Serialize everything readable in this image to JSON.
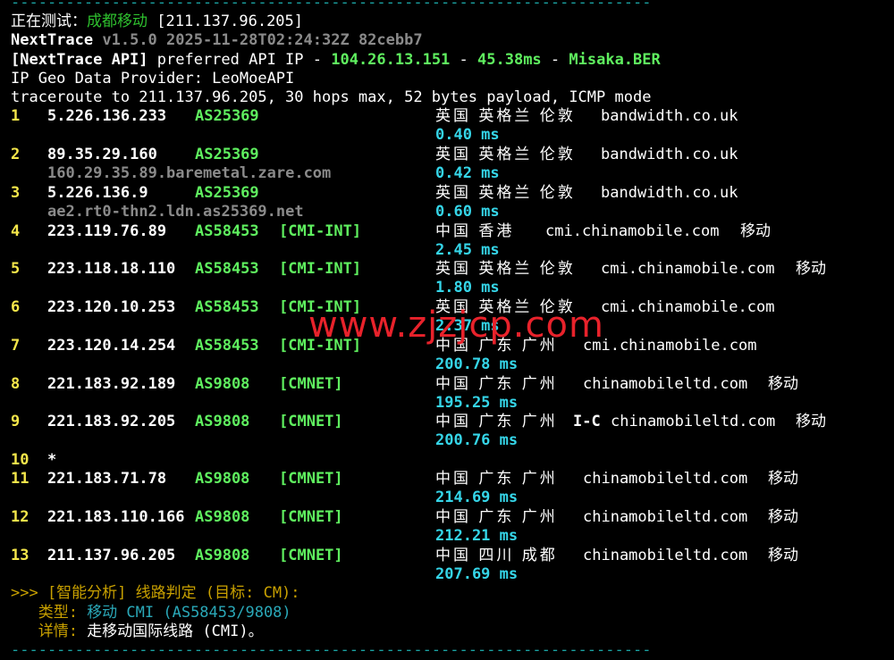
{
  "separator": "----------------------------------------------------------------------",
  "testing": {
    "label": "正在测试：",
    "target_name": "成都移动",
    "target_ip": "[211.137.96.205]"
  },
  "version": {
    "app": "NextTrace",
    "info": "v1.5.0 2025-11-28T02:24:32Z 82cebb7"
  },
  "api": {
    "prefix": "[NextTrace API]",
    "text": " preferred API IP - ",
    "ip": "104.26.13.151",
    "dash1": " - ",
    "latency": "45.38ms",
    "dash2": " - ",
    "node": "Misaka.BER"
  },
  "geo_provider": "IP Geo Data Provider: LeoMoeAPI",
  "traceroute": "traceroute to 211.137.96.205, 30 hops max, 52 bytes payload, ICMP mode",
  "hops": [
    {
      "n": "1",
      "ip": "5.226.136.233",
      "asn": "AS25369",
      "tag": "",
      "geo": "英国 英格兰 伦敦",
      "domain": "bandwidth.co.uk",
      "isp": "",
      "rdns": "",
      "rtt": "0.40 ms"
    },
    {
      "n": "2",
      "ip": "89.35.29.160",
      "asn": "AS25369",
      "tag": "",
      "geo": "英国 英格兰 伦敦",
      "domain": "bandwidth.co.uk",
      "isp": "",
      "rdns": "160.29.35.89.baremetal.zare.com",
      "rtt": "0.42 ms"
    },
    {
      "n": "3",
      "ip": "5.226.136.9",
      "asn": "AS25369",
      "tag": "",
      "geo": "英国 英格兰 伦敦",
      "domain": "bandwidth.co.uk",
      "isp": "",
      "rdns": "ae2.rt0-thn2.ldn.as25369.net",
      "rtt": "0.60 ms"
    },
    {
      "n": "4",
      "ip": "223.119.76.89",
      "asn": "AS58453",
      "tag": "[CMI-INT]",
      "geo": "中国 香港",
      "domain": "cmi.chinamobile.com",
      "isp": "移动",
      "rdns": "",
      "rtt": "2.45 ms"
    },
    {
      "n": "5",
      "ip": "223.118.18.110",
      "asn": "AS58453",
      "tag": "[CMI-INT]",
      "geo": "英国 英格兰 伦敦",
      "domain": "cmi.chinamobile.com",
      "isp": "移动",
      "rdns": "",
      "rtt": "1.80 ms"
    },
    {
      "n": "6",
      "ip": "223.120.10.253",
      "asn": "AS58453",
      "tag": "[CMI-INT]",
      "geo": "英国 英格兰 伦敦",
      "domain": "cmi.chinamobile.com",
      "isp": "",
      "rdns": "",
      "rtt": "2.37 ms"
    },
    {
      "n": "7",
      "ip": "223.120.14.254",
      "asn": "AS58453",
      "tag": "[CMI-INT]",
      "geo": "中国 广东 广州",
      "domain": "cmi.chinamobile.com",
      "isp": "",
      "rdns": "",
      "rtt": "200.78 ms"
    },
    {
      "n": "8",
      "ip": "221.183.92.189",
      "asn": "AS9808",
      "tag": "[CMNET]",
      "geo": "中国 广东 广州",
      "domain": "chinamobileltd.com",
      "isp": "移动",
      "rdns": "",
      "rtt": "195.25 ms"
    },
    {
      "n": "9",
      "ip": "221.183.92.205",
      "asn": "AS9808",
      "tag": "[CMNET]",
      "geo": "中国 广东 广州",
      "geo_extra": "I-C",
      "domain": "chinamobileltd.com",
      "isp": "移动",
      "rdns": "",
      "rtt": "200.76 ms"
    },
    {
      "n": "10",
      "ip": "*",
      "asn": "",
      "tag": "",
      "geo": "",
      "domain": "",
      "isp": "",
      "rdns": "",
      "rtt": ""
    },
    {
      "n": "11",
      "ip": "221.183.71.78",
      "asn": "AS9808",
      "tag": "[CMNET]",
      "geo": "中国 广东 广州",
      "domain": "chinamobileltd.com",
      "isp": "移动",
      "rdns": "",
      "rtt": "214.69 ms"
    },
    {
      "n": "12",
      "ip": "221.183.110.166",
      "asn": "AS9808",
      "tag": "[CMNET]",
      "geo": "中国 广东 广州",
      "domain": "chinamobileltd.com",
      "isp": "移动",
      "rdns": "",
      "rtt": "212.21 ms"
    },
    {
      "n": "13",
      "ip": "211.137.96.205",
      "asn": "AS9808",
      "tag": "[CMNET]",
      "geo": "中国 四川 成都",
      "domain": "chinamobileltd.com",
      "isp": "移动",
      "rdns": "",
      "rtt": "207.69 ms"
    }
  ],
  "analysis": {
    "header": ">>> [智能分析] 线路判定 (目标: CM):",
    "type_label": "   类型: ",
    "type_value": "移动 CMI (AS58453/9808)",
    "detail_label": "   详情: ",
    "detail_value": "走移动国际线路 (CMI)。"
  },
  "watermark": "www.zjzjcp.com"
}
